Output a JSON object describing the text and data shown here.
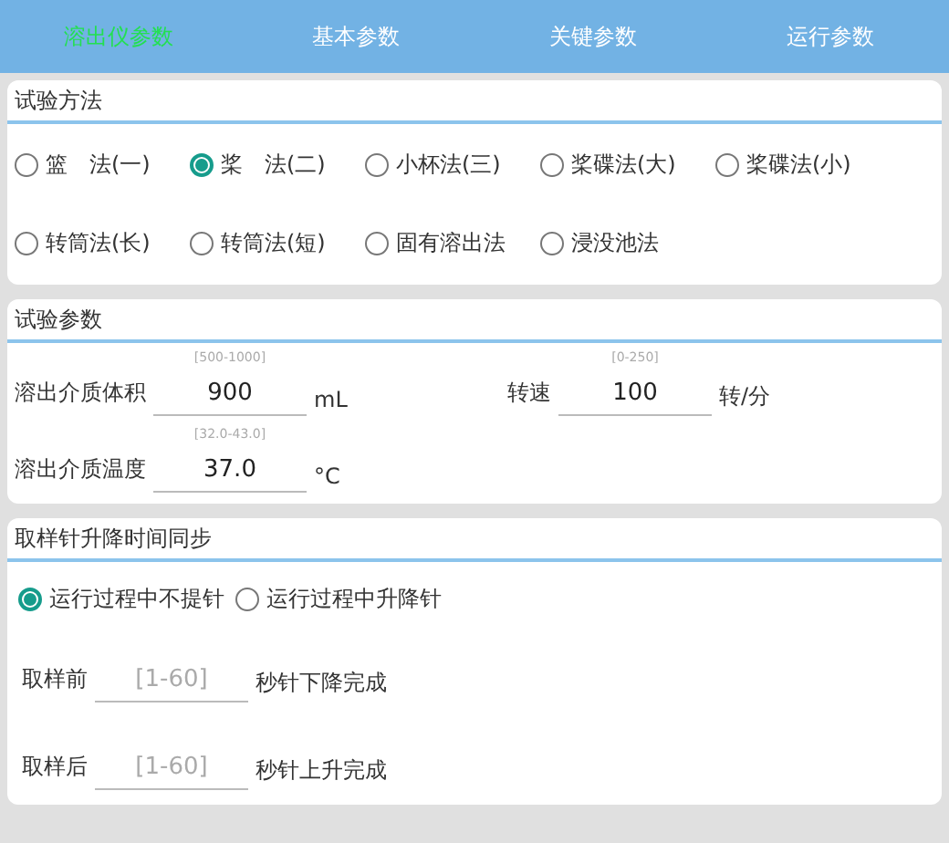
{
  "tabs": [
    {
      "label": "溶出仪参数",
      "selected": true
    },
    {
      "label": "基本参数",
      "selected": false
    },
    {
      "label": "关键参数",
      "selected": false
    },
    {
      "label": "运行参数",
      "selected": false
    }
  ],
  "method_section": {
    "title": "试验方法",
    "options": [
      {
        "label": "篮　法(一)",
        "selected": false
      },
      {
        "label": "桨　法(二)",
        "selected": true
      },
      {
        "label": "小杯法(三)",
        "selected": false
      },
      {
        "label": "桨碟法(大)",
        "selected": false
      },
      {
        "label": "桨碟法(小)",
        "selected": false
      },
      {
        "label": "转筒法(长)",
        "selected": false
      },
      {
        "label": "转筒法(短)",
        "selected": false
      },
      {
        "label": "固有溶出法",
        "selected": false
      },
      {
        "label": "浸没池法",
        "selected": false
      }
    ]
  },
  "params_section": {
    "title": "试验参数",
    "fields": [
      {
        "label": "溶出介质体积",
        "range": "[500-1000]",
        "value": "900",
        "unit": "mL"
      },
      {
        "label": "转速",
        "range": "[0-250]",
        "value": "100",
        "unit": "转/分"
      },
      {
        "label": "溶出介质温度",
        "range": "[32.0-43.0]",
        "value": "37.0",
        "unit": "°C"
      }
    ]
  },
  "sync_section": {
    "title": "取样针升降时间同步",
    "options": [
      {
        "label": "运行过程中不提针",
        "selected": true
      },
      {
        "label": "运行过程中升降针",
        "selected": false
      }
    ],
    "fields": [
      {
        "label": "取样前",
        "placeholder": "[1-60]",
        "unit": "秒针下降完成"
      },
      {
        "label": "取样后",
        "placeholder": "[1-60]",
        "unit": "秒针上升完成"
      }
    ]
  }
}
